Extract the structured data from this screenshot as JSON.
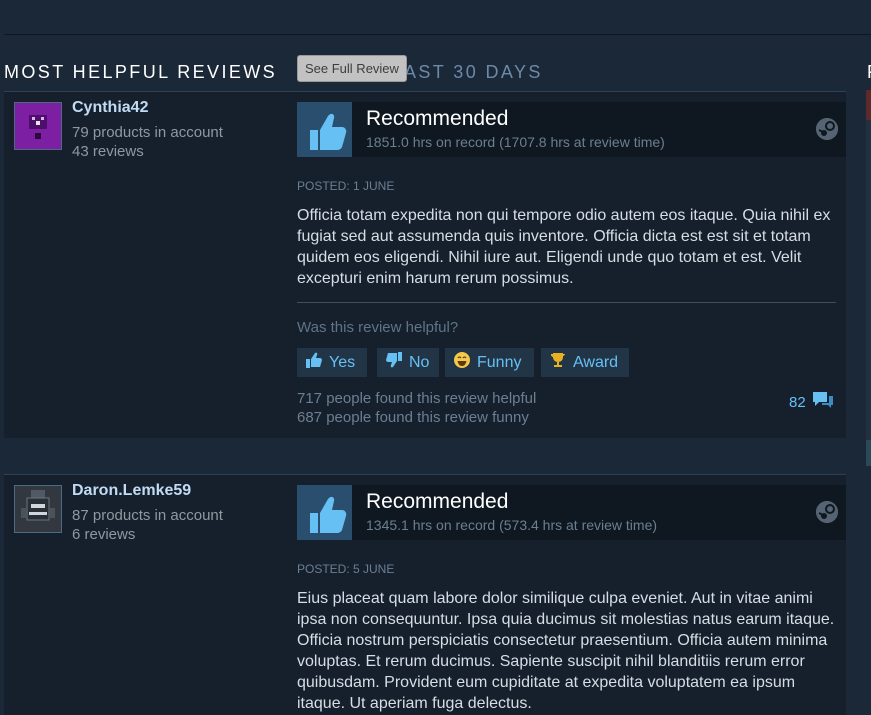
{
  "top_clipped_text": "",
  "section": {
    "title": "MOST HELPFUL REVIEWS",
    "subtitle": "AST 30 DAYS"
  },
  "tooltip": "See Full Review",
  "sidebar_letter": "F",
  "reviews": [
    {
      "username": "Cynthia42",
      "products": "79 products in account",
      "reviews": "43 reviews",
      "verdict": "Recommended",
      "hours": "1851.0 hrs on record (1707.8 hrs at review time)",
      "posted": "POSTED: 1 JUNE",
      "body": "Officia totam expedita non qui tempore odio autem eos itaque. Quia nihil ex fugiat sed aut assumenda quis inventore. Officia dicta est est sit et totam quidem eos eligendi. Nihil iure aut. Eligendi unde quo totam et est. Velit excepturi enim harum rerum possimus.",
      "helpful_question": "Was this review helpful?",
      "buttons": {
        "yes": "Yes",
        "no": "No",
        "funny": "Funny",
        "award": "Award"
      },
      "found_helpful": "717 people found this review helpful",
      "found_funny": "687 people found this review funny",
      "comment_count": "82"
    },
    {
      "username": "Daron.Lemke59",
      "products": "87 products in account",
      "reviews": "6 reviews",
      "verdict": "Recommended",
      "hours": "1345.1 hrs on record (573.4 hrs at review time)",
      "posted": "POSTED: 5 JUNE",
      "body": "Eius placeat quam labore dolor similique culpa eveniet. Aut in vitae animi ipsa non consequuntur. Ipsa quia ducimus sit molestias natus earum itaque. Officia nostrum perspiciatis consectetur praesentium. Officia autem minima voluptas. Et rerum ducimus. Sapiente suscipit nihil blanditiis rerum error quibusdam. Provident eum cupiditate at expedita voluptatem ea ipsum itaque. Ut aperiam fuga delectus."
    }
  ],
  "colors": {
    "background": "#1b2838",
    "card": "#16202d",
    "accent": "#66c0f4",
    "thumb_box": "#2a4f6e"
  }
}
